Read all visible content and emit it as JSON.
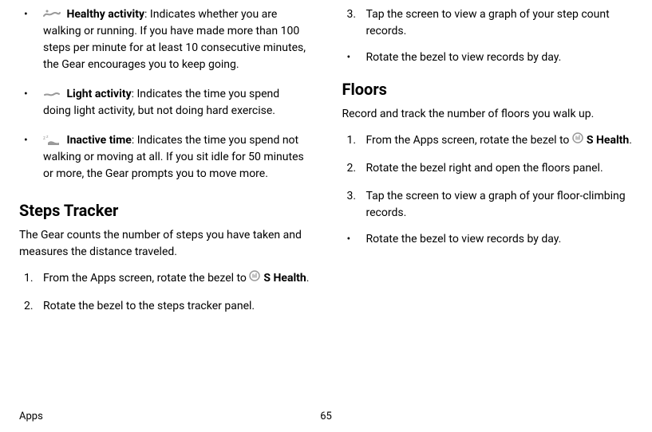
{
  "left": {
    "bullets": [
      {
        "label": "Healthy activity",
        "text": ": Indicates whether you are walking or running. If you have made more than 100 steps per minute for at least 10 consecutive minutes, the Gear encourages you to keep going."
      },
      {
        "label": "Light activity",
        "text": ": Indicates the time you spend doing light activity, but not doing hard exercise."
      },
      {
        "label": "Inactive time",
        "text": ": Indicates the time you spend not walking or moving at all. If you sit idle for 50 minutes or more, the Gear prompts you to move more."
      }
    ],
    "heading": "Steps Tracker",
    "intro": "The Gear counts the number of steps you have taken and measures the distance traveled.",
    "steps": {
      "s1_pre": "From the Apps screen, rotate the bezel to ",
      "s1_app": "S Health",
      "s1_post": ".",
      "s2": "Rotate the bezel to the steps tracker panel."
    }
  },
  "right": {
    "step3": {
      "text": "Tap the screen to view a graph of your step count records.",
      "sub": "Rotate the bezel to view records by day."
    },
    "floors_heading": "Floors",
    "floors_intro": "Record and track the number of floors you walk up.",
    "floors_steps": {
      "s1_pre": "From the Apps screen, rotate the bezel to ",
      "s1_app": "S Health",
      "s1_post": ".",
      "s2": "Rotate the bezel right and open the floors panel.",
      "s3": "Tap the screen to view a graph of your floor-climbing records.",
      "s3_sub": "Rotate the bezel to view records by day."
    }
  },
  "footer": {
    "section": "Apps",
    "page": "65"
  }
}
